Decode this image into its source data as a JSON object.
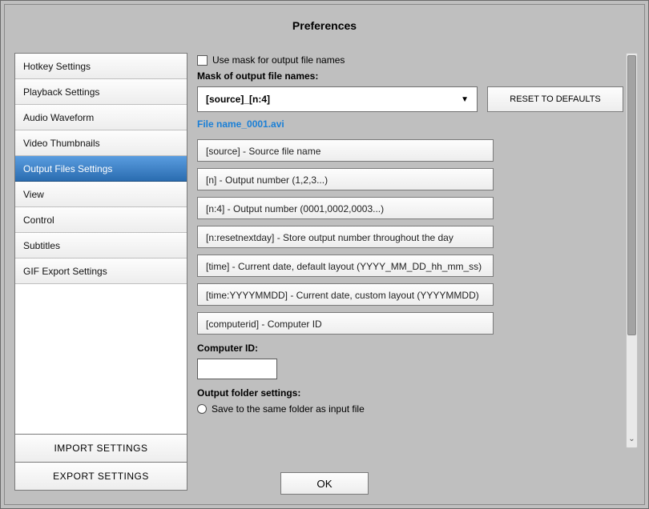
{
  "title": "Preferences",
  "sidebar": {
    "items": [
      {
        "label": "Hotkey Settings",
        "selected": false
      },
      {
        "label": "Playback Settings",
        "selected": false
      },
      {
        "label": "Audio Waveform",
        "selected": false
      },
      {
        "label": "Video Thumbnails",
        "selected": false
      },
      {
        "label": "Output Files Settings",
        "selected": true
      },
      {
        "label": "View",
        "selected": false
      },
      {
        "label": "Control",
        "selected": false
      },
      {
        "label": "Subtitles",
        "selected": false
      },
      {
        "label": "GIF Export Settings",
        "selected": false
      }
    ],
    "import_label": "IMPORT SETTINGS",
    "export_label": "EXPORT SETTINGS"
  },
  "main": {
    "use_mask_checkbox": {
      "checked": false,
      "label": "Use mask for output file names"
    },
    "mask_label": "Mask of output file names:",
    "mask_value": "[source]_[n:4]",
    "reset_label": "RESET TO DEFAULTS",
    "preview": "File name_0001.avi",
    "tokens": [
      "[source] - Source file name",
      "[n] - Output number (1,2,3...)",
      "[n:4] - Output number (0001,0002,0003...)",
      "[n:resetnextday] - Store output number throughout the day",
      "[time] - Current date, default layout (YYYY_MM_DD_hh_mm_ss)",
      "[time:YYYYMMDD] - Current date, custom layout (YYYYMMDD)",
      "[computerid] - Computer ID"
    ],
    "computer_id_label": "Computer ID:",
    "computer_id_value": "",
    "output_folder_label": "Output folder settings:",
    "save_same_folder": {
      "selected": false,
      "label": "Save to the same folder as input file"
    }
  },
  "footer": {
    "ok_label": "OK"
  }
}
